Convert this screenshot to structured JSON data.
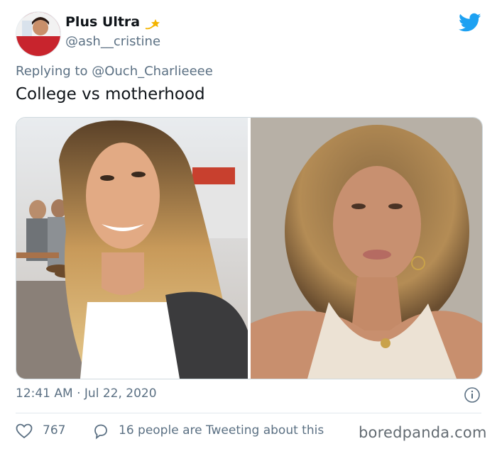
{
  "author": {
    "display_name": "Plus Ultra",
    "handle": "@ash__cristine"
  },
  "reply_context": {
    "prefix": "Replying to",
    "mention": "@Ouch_Charlieeee"
  },
  "tweet": {
    "text": "College vs motherhood",
    "timestamp": "12:41 AM · Jul 22, 2020"
  },
  "engagement": {
    "likes": "767",
    "conversation": "16 people are Tweeting about this"
  },
  "watermark": "boredpanda.com",
  "icons": {
    "badge": "shooting-star-icon",
    "brand": "twitter-bird-icon",
    "info": "info-icon",
    "like": "heart-icon",
    "reply": "speech-bubble-icon"
  },
  "colors": {
    "brand": "#1da1f2",
    "text_primary": "#0f1419",
    "text_secondary": "#5b7083",
    "badge": "#f4b400"
  }
}
